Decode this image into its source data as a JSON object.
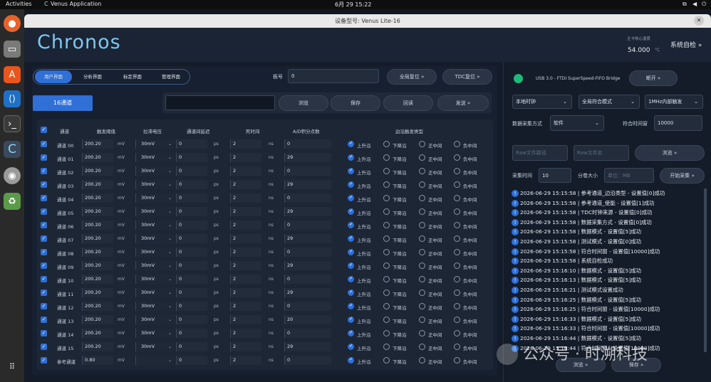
{
  "os": {
    "activities": "Activities",
    "app_name": "Venus Application",
    "clock": "6月 29 15:22"
  },
  "window": {
    "title": "设备型号: Venus Lite-16"
  },
  "header": {
    "logo": "Chronos",
    "temp_label": "主卡核心温度",
    "temp_value": "54.000",
    "temp_unit": "°C",
    "self_check": "系统自检"
  },
  "tabs": [
    {
      "label": "用户界面",
      "active": true
    },
    {
      "label": "分析界面"
    },
    {
      "label": "标定界面"
    },
    {
      "label": "管理界面"
    }
  ],
  "board": {
    "label": "板号",
    "value": "0",
    "reset_all": "全局复位",
    "reset_tdc": "TDC复位"
  },
  "toolbar": {
    "channels": "16通道",
    "browse": "浏览",
    "save": "保存",
    "readback": "回读",
    "send": "发送"
  },
  "table": {
    "headers": [
      "通道",
      "触发阈值",
      "拉滞电压",
      "通道间延迟",
      "死时间",
      "A/D积分点数",
      "边沿触发类型"
    ],
    "edge_labels": [
      "上升沿",
      "下降沿",
      "正中间",
      "负中间"
    ],
    "rows": [
      {
        "ch": "通道 00",
        "thr": "200.20",
        "hyst": "30mV",
        "delay": "0",
        "dead": "2",
        "ad": "0"
      },
      {
        "ch": "通道 01",
        "thr": "200.20",
        "hyst": "30mV",
        "delay": "0",
        "dead": "2",
        "ad": "29"
      },
      {
        "ch": "通道 02",
        "thr": "200.20",
        "hyst": "30mV",
        "delay": "0",
        "dead": "2",
        "ad": "0"
      },
      {
        "ch": "通道 03",
        "thr": "200.20",
        "hyst": "30mV",
        "delay": "0",
        "dead": "2",
        "ad": "29"
      },
      {
        "ch": "通道 04",
        "thr": "200.20",
        "hyst": "30mV",
        "delay": "0",
        "dead": "2",
        "ad": "0"
      },
      {
        "ch": "通道 05",
        "thr": "200.20",
        "hyst": "30mV",
        "delay": "0",
        "dead": "2",
        "ad": "29"
      },
      {
        "ch": "通道 06",
        "thr": "200.20",
        "hyst": "30mV",
        "delay": "0",
        "dead": "2",
        "ad": "0"
      },
      {
        "ch": "通道 07",
        "thr": "200.20",
        "hyst": "30mV",
        "delay": "0",
        "dead": "2",
        "ad": "29"
      },
      {
        "ch": "通道 08",
        "thr": "200.20",
        "hyst": "30mV",
        "delay": "0",
        "dead": "2",
        "ad": "0"
      },
      {
        "ch": "通道 09",
        "thr": "200.20",
        "hyst": "30mV",
        "delay": "0",
        "dead": "2",
        "ad": "29"
      },
      {
        "ch": "通道 10",
        "thr": "200.20",
        "hyst": "30mV",
        "delay": "0",
        "dead": "2",
        "ad": "0"
      },
      {
        "ch": "通道 11",
        "thr": "200.20",
        "hyst": "30mV",
        "delay": "0",
        "dead": "2",
        "ad": "29"
      },
      {
        "ch": "通道 12",
        "thr": "200.20",
        "hyst": "30mV",
        "delay": "0",
        "dead": "2",
        "ad": "0"
      },
      {
        "ch": "通道 13",
        "thr": "200.20",
        "hyst": "30mV",
        "delay": "0",
        "dead": "2",
        "ad": "20"
      },
      {
        "ch": "通道 14",
        "thr": "200.20",
        "hyst": "30mV",
        "delay": "0",
        "dead": "2",
        "ad": "0"
      },
      {
        "ch": "通道 15",
        "thr": "200.20",
        "hyst": "30mV",
        "delay": "0",
        "dead": "2",
        "ad": "29"
      },
      {
        "ch": "参考通道",
        "thr": "0.80",
        "hyst": "",
        "delay": "0",
        "dead": "2",
        "ad": "0"
      }
    ],
    "units": {
      "thr": "mV",
      "delay": "ps",
      "dead": "ns"
    }
  },
  "right": {
    "usb_label": "USB 3.0 - FTDI SuperSpeed-FIFO Bridge",
    "disconnect": "断开",
    "clock": "本地时钟",
    "coincidence": "全局符合模式",
    "trigger": "1MHz内部触发",
    "acq_mode_label": "数据采集方式",
    "acq_mode": "软件",
    "window_label": "符合时间窗",
    "window_value": "10000",
    "raw_path_ph": "Raw文件路径",
    "raw_name_ph": "Raw文件名",
    "browse": "浏览",
    "acq_time_label": "采集时间",
    "acq_time": "10",
    "split_label": "分卷大小",
    "split_ph": "单位：MB",
    "start": "开始采集",
    "log_browse": "浏览",
    "log_save": "保存"
  },
  "log": [
    "2026-06-29 15:15:58 | 参考通道_边沿类型 - 设置值[0]成功",
    "2026-06-29 15:15:58 | 参考通道_使能 - 设置值[1]成功",
    "2026-06-29 15:15:58 | TDC时钟来源 - 设置值[0]成功",
    "2026-06-29 15:15:58 | 数据采集方式 - 设置值[0]成功",
    "2026-06-29 15:15:58 | 数据模式 - 设置值[5]成功",
    "2026-06-29 15:15:58 | 测试模式 - 设置值[0]成功",
    "2026-06-29 15:15:58 | 符合时间窗 - 设置值[10000]成功",
    "2026-06-29 15:15:58 | 系统自检成功",
    "2026-06-29 15:16:10 | 数据模式 - 设置值[5]成功",
    "2026-06-29 15:16:13 | 数据模式 - 设置值[5]成功",
    "2026-06-29 15:16:21 | 测试模式设置成功",
    "2026-06-29 15:16:25 | 数据模式 - 设置值[5]成功",
    "2026-06-29 15:16:25 | 符合时间窗 - 设置值[10000]成功",
    "2026-06-29 15:16:33 | 数据模式 - 设置值[5]成功",
    "2026-06-29 15:16:33 | 符合时间窗 - 设置值[10000]成功",
    "2026-06-29 15:16:44 | 数据模式 - 设置值[5]成功",
    "2026-06-29 15:16:44 | 符合时间窗 - 设置值[10000]成功"
  ],
  "watermark": "公众号 · 时溯科技",
  "colors": {
    "accent": "#2d6fd6",
    "bg": "#141c29",
    "panel": "#1a2331",
    "usb_led": "#1fb97a"
  }
}
